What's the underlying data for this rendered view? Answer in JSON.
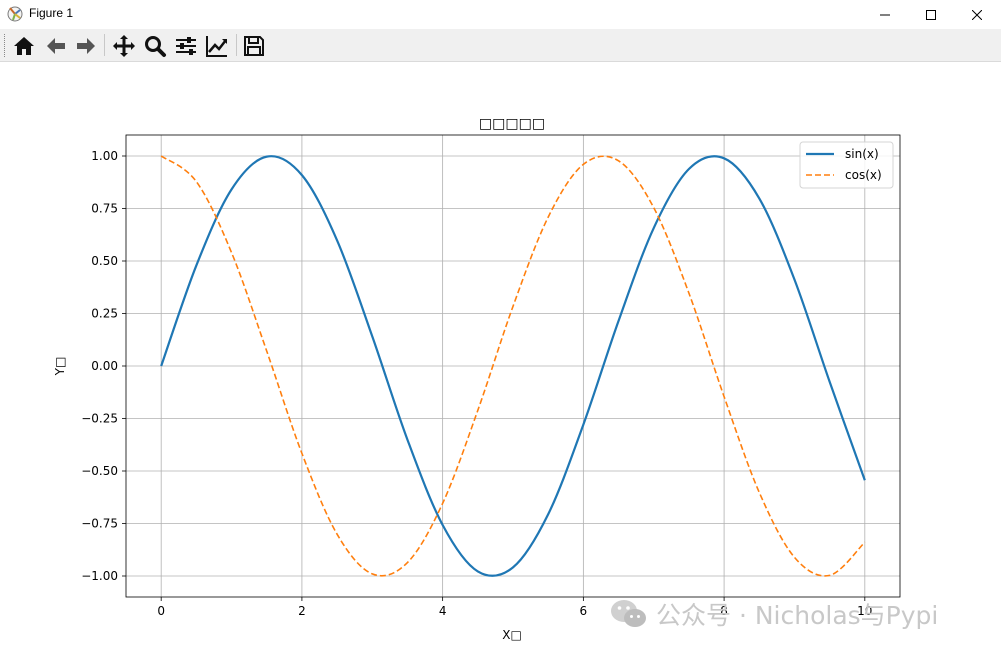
{
  "window": {
    "title": "Figure 1"
  },
  "toolbar": {
    "buttons": [
      {
        "icon": "home-icon"
      },
      {
        "icon": "back-arrow-icon"
      },
      {
        "icon": "forward-arrow-icon"
      },
      {
        "icon": "pan-move-icon"
      },
      {
        "icon": "zoom-magnifier-icon"
      },
      {
        "icon": "subplots-sliders-icon"
      },
      {
        "icon": "edit-axes-chart-icon"
      },
      {
        "icon": "save-floppy-icon"
      }
    ]
  },
  "watermark": {
    "text": "公众号 · Nicholas与Pypi",
    "icon": "wechat-icon"
  },
  "colors": {
    "sin": "#1f77b4",
    "cos": "#ff7f0e",
    "grid": "#b0b0b0"
  },
  "chart_data": {
    "type": "line",
    "title": "□□□□□",
    "xlabel": "X□",
    "ylabel": "Y□",
    "xlim": [
      -0.5,
      10.5
    ],
    "ylim": [
      -1.1,
      1.1
    ],
    "xticks": [
      0,
      2,
      4,
      6,
      8,
      10
    ],
    "xtick_labels": [
      "0",
      "2",
      "4",
      "6",
      "8",
      "10"
    ],
    "yticks": [
      -1.0,
      -0.75,
      -0.5,
      -0.25,
      0.0,
      0.25,
      0.5,
      0.75,
      1.0
    ],
    "ytick_labels": [
      "−1.00",
      "−0.75",
      "−0.50",
      "−0.25",
      "0.00",
      "0.25",
      "0.50",
      "0.75",
      "1.00"
    ],
    "grid": true,
    "legend_position": "upper right",
    "x": [
      0.0,
      0.5,
      1.0,
      1.5,
      2.0,
      2.5,
      3.0,
      3.5,
      4.0,
      4.5,
      5.0,
      5.5,
      6.0,
      6.5,
      7.0,
      7.5,
      8.0,
      8.5,
      9.0,
      9.5,
      10.0
    ],
    "series": [
      {
        "name": "sin(x)",
        "style": "solid",
        "color": "#1f77b4",
        "values": [
          0.0,
          0.479,
          0.841,
          0.997,
          0.909,
          0.598,
          0.141,
          -0.351,
          -0.757,
          -0.978,
          -0.959,
          -0.706,
          -0.279,
          0.215,
          0.657,
          0.938,
          0.989,
          0.798,
          0.412,
          -0.075,
          -0.544
        ]
      },
      {
        "name": "cos(x)",
        "style": "dashed",
        "color": "#ff7f0e",
        "values": [
          1.0,
          0.878,
          0.54,
          0.071,
          -0.416,
          -0.801,
          -0.99,
          -0.936,
          -0.654,
          -0.211,
          0.284,
          0.709,
          0.96,
          0.977,
          0.754,
          0.347,
          -0.146,
          -0.602,
          -0.911,
          -0.997,
          -0.839
        ]
      }
    ]
  }
}
